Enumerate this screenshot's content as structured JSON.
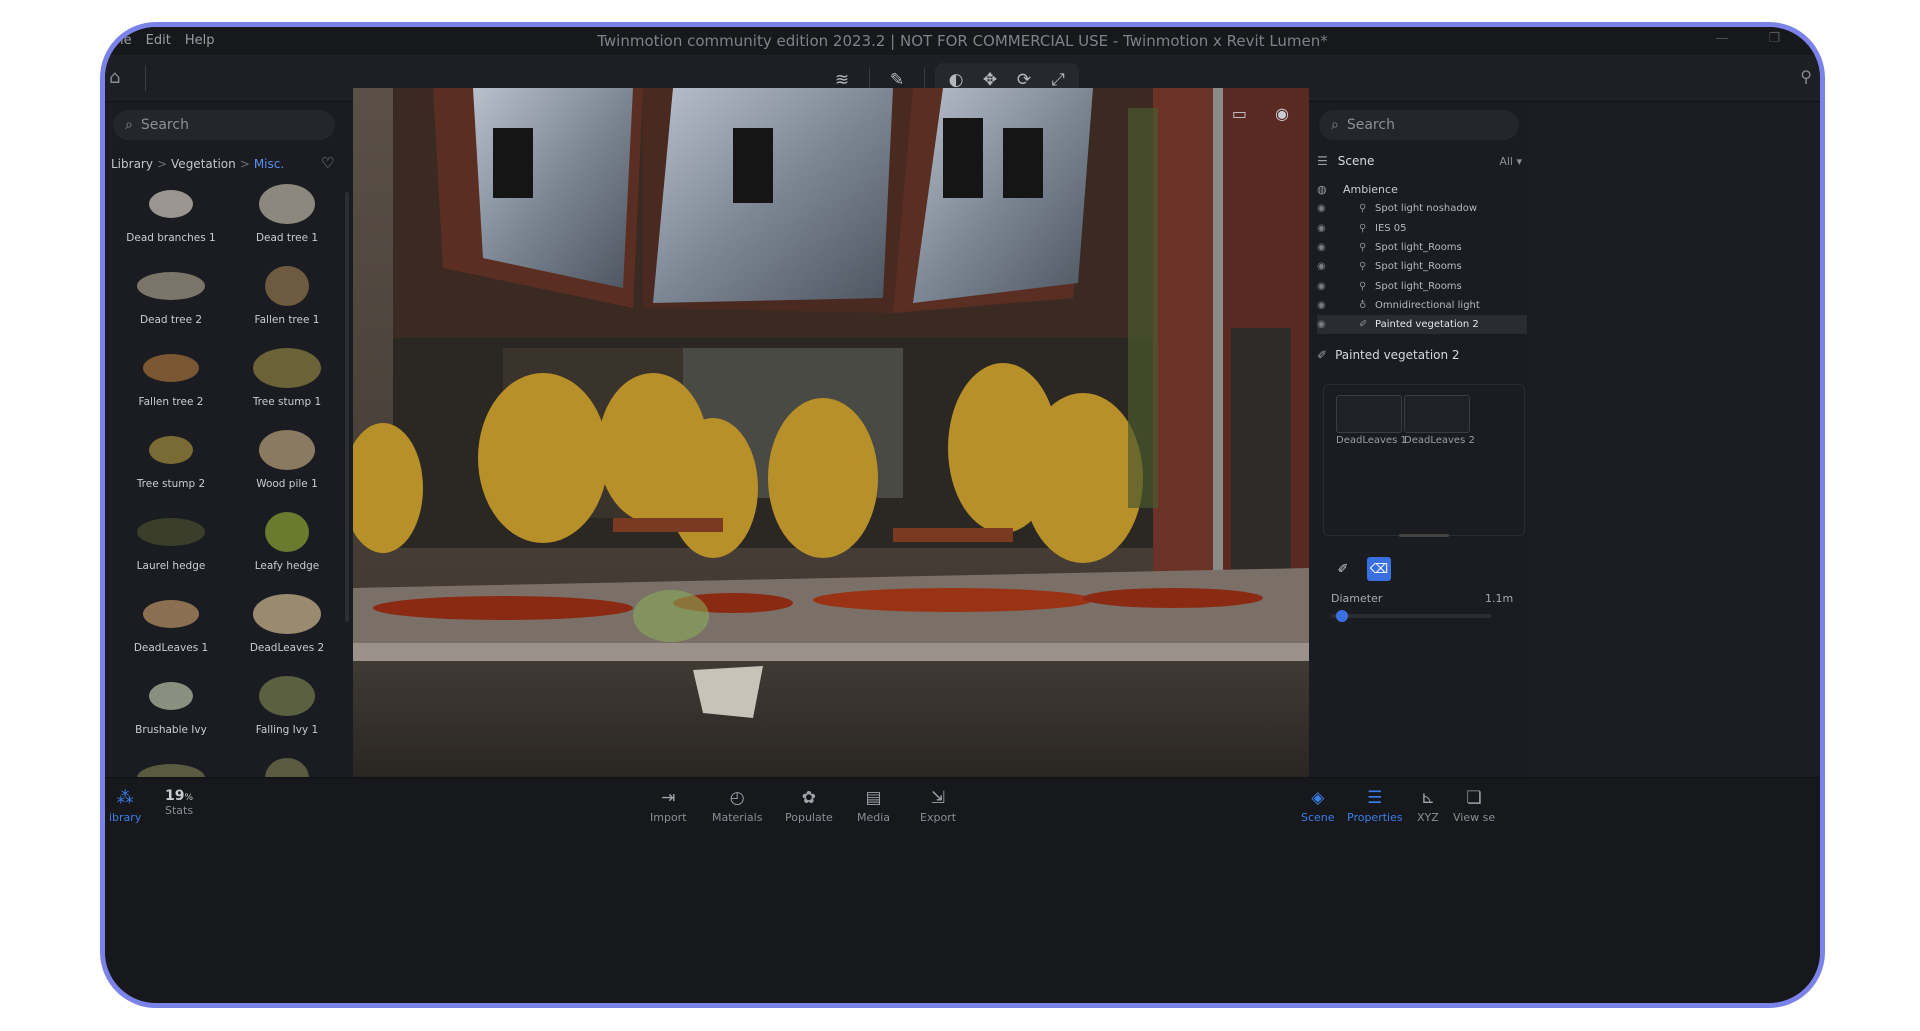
{
  "window": {
    "menu": [
      "File",
      "Edit",
      "Help"
    ],
    "menu_visible": [
      "le",
      "Edit",
      "Help"
    ],
    "title": "Twinmotion community edition 2023.2 | NOT FOR COMMERCIAL USE - Twinmotion x Revit Lumen*"
  },
  "library": {
    "search_placeholder": "Search",
    "breadcrumb": [
      "Library",
      "Vegetation",
      "Misc."
    ],
    "assets": [
      {
        "label": "Dead branches 1",
        "color": "#9a958e"
      },
      {
        "label": "Dead tree 1",
        "color": "#8c877f"
      },
      {
        "label": "Dead tree 2",
        "color": "#7b7468"
      },
      {
        "label": "Fallen tree 1",
        "color": "#6e5a3e"
      },
      {
        "label": "Fallen tree 2",
        "color": "#7a5632"
      },
      {
        "label": "Tree stump 1",
        "color": "#6c6238"
      },
      {
        "label": "Tree stump 2",
        "color": "#7a6a34"
      },
      {
        "label": "Wood pile 1",
        "color": "#8a7a62"
      },
      {
        "label": "Laurel hedge",
        "color": "#3a3e2a"
      },
      {
        "label": "Leafy hedge",
        "color": "#6a7a2e"
      },
      {
        "label": "DeadLeaves 1",
        "color": "#8a7050"
      },
      {
        "label": "DeadLeaves 2",
        "color": "#9a8a70"
      },
      {
        "label": "Brushable Ivy",
        "color": "#8a9080"
      },
      {
        "label": "Falling Ivy 1",
        "color": "#5a6040"
      },
      {
        "label": "",
        "color": "#5a5a40"
      },
      {
        "label": "",
        "color": "#5a5a40"
      }
    ]
  },
  "scene": {
    "search_placeholder": "Search",
    "header": "Scene",
    "filter": "All",
    "root": "Ambience",
    "items": [
      {
        "label": "Spot light noshadow",
        "icon": "spotlight-icon"
      },
      {
        "label": "IES 05",
        "icon": "spotlight-icon"
      },
      {
        "label": "Spot light_Rooms",
        "icon": "spotlight-icon"
      },
      {
        "label": "Spot light_Rooms",
        "icon": "spotlight-icon"
      },
      {
        "label": "Spot light_Rooms",
        "icon": "spotlight-icon"
      },
      {
        "label": "Omnidirectional light",
        "icon": "bulb-icon"
      },
      {
        "label": "Painted vegetation 2",
        "icon": "brush-icon"
      }
    ]
  },
  "properties": {
    "title": "Painted vegetation 2",
    "items": [
      "DeadLeaves 1",
      "DeadLeaves 2"
    ],
    "diameter_label": "Diameter",
    "diameter_value": "1.1m",
    "diameter_fraction": 0.03
  },
  "bottom": {
    "left": [
      {
        "label": "Library",
        "visible_label": "ibrary",
        "icon": "library-icon",
        "active": true
      },
      {
        "label": "Stats",
        "value": "19",
        "unit": "%",
        "icon": "stats-icon"
      }
    ],
    "center": [
      {
        "label": "Import",
        "icon": "import-icon"
      },
      {
        "label": "Materials",
        "icon": "materials-icon"
      },
      {
        "label": "Populate",
        "icon": "populate-icon"
      },
      {
        "label": "Media",
        "icon": "media-icon"
      },
      {
        "label": "Export",
        "icon": "export-icon"
      }
    ],
    "right": [
      {
        "label": "Scene",
        "icon": "scene-icon",
        "active": true
      },
      {
        "label": "Properties",
        "icon": "properties-icon",
        "active": true
      },
      {
        "label": "XYZ",
        "icon": "xyz-icon"
      },
      {
        "label": "View set",
        "visible_label": "View se",
        "icon": "viewset-icon"
      }
    ]
  },
  "colors": {
    "accent": "#3a7ee8",
    "frame": "#7c83e8"
  }
}
